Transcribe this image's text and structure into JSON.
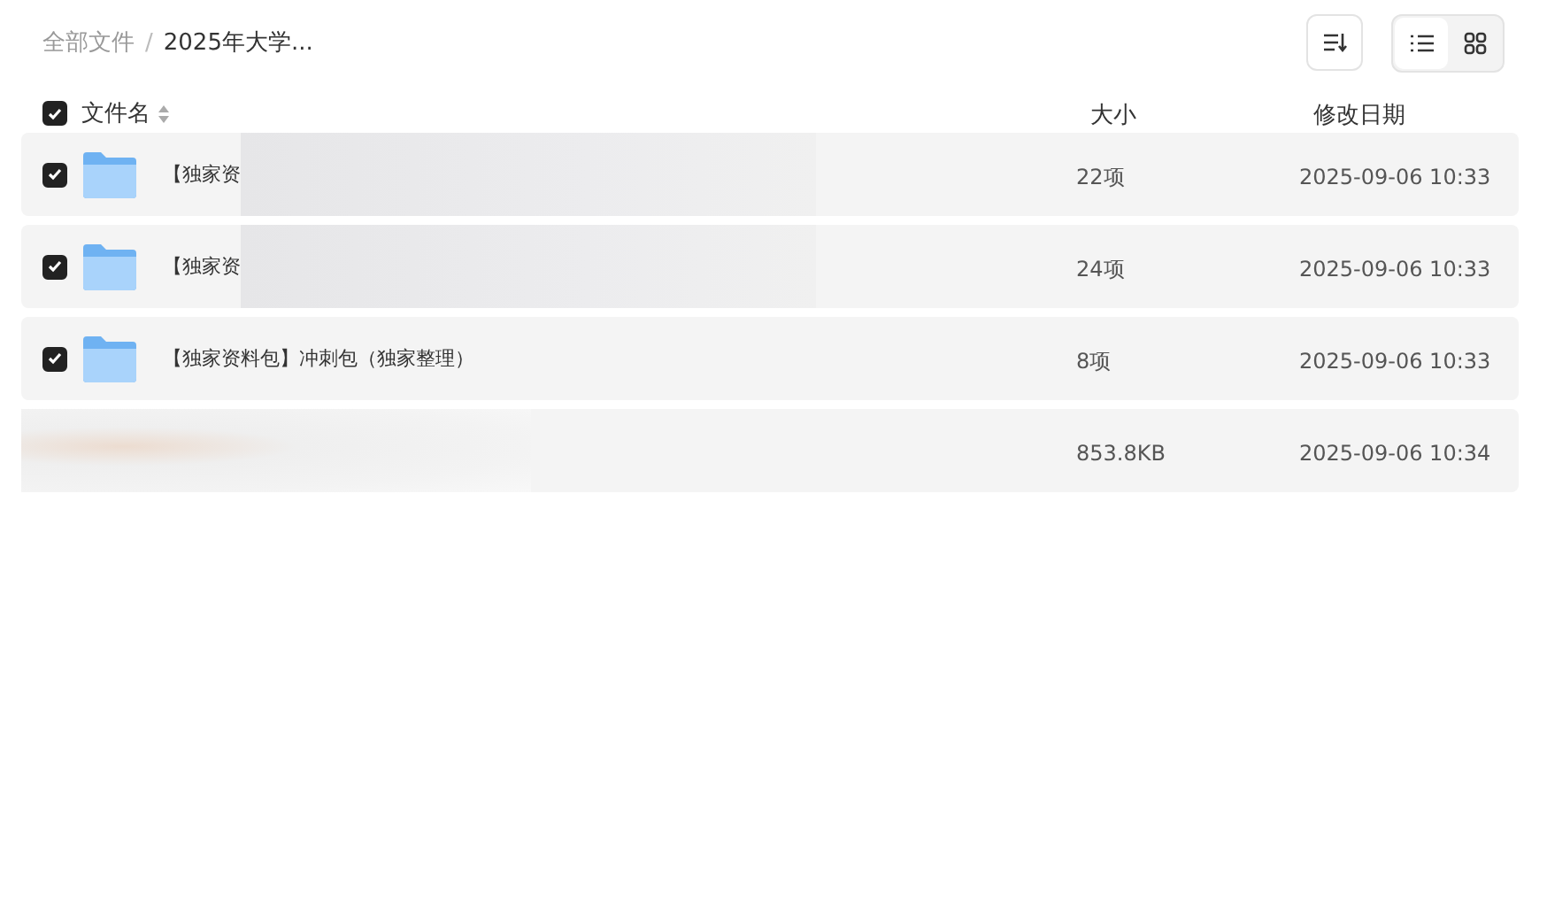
{
  "breadcrumb_separator": "/",
  "breadcrumb": [
    {
      "label": "全部文件",
      "current": false
    },
    {
      "label": "2025年大学...",
      "current": true
    }
  ],
  "view_toggle": [
    {
      "kind": "list",
      "selected": true
    },
    {
      "kind": "grid",
      "selected": false
    }
  ],
  "table": {
    "all_checked": true,
    "columns": [
      "文件名",
      "大小",
      "修改日期"
    ],
    "rows": [
      {
        "kind": "folder",
        "checked": true,
        "name": "【独家资",
        "name_blurred": true,
        "size": "22项",
        "modified": "2025-09-06 10:33"
      },
      {
        "kind": "folder",
        "checked": true,
        "name": "【独家资",
        "name_blurred": true,
        "size": "24项",
        "modified": "2025-09-06 10:33"
      },
      {
        "kind": "folder",
        "checked": true,
        "name": "【独家资料包】冲刺包（独家整理）",
        "name_blurred": false,
        "size": "8项",
        "modified": "2025-09-06 10:33"
      },
      {
        "kind": "hidden",
        "size": "853.8KB",
        "modified": "2025-09-06 10:34"
      }
    ]
  }
}
